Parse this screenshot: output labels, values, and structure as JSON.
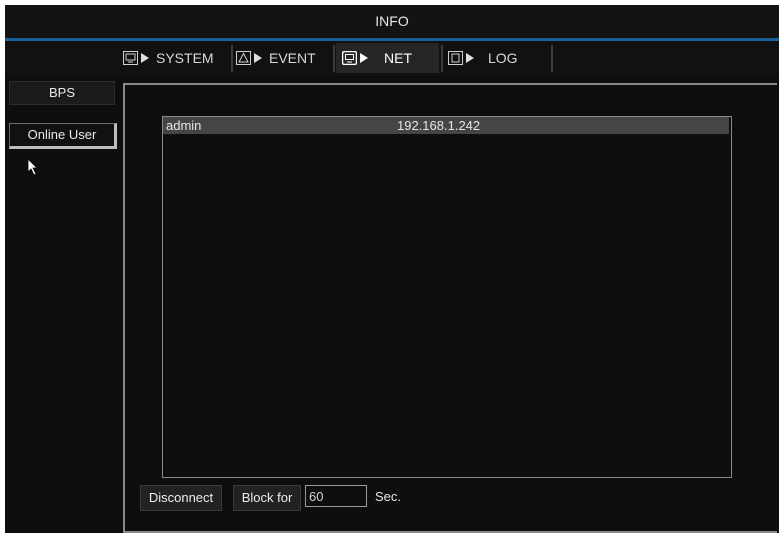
{
  "window": {
    "title": "INFO"
  },
  "tabs": [
    {
      "label": "SYSTEM",
      "icon": "monitor-icon",
      "active": false
    },
    {
      "label": "EVENT",
      "icon": "warning-icon",
      "active": false
    },
    {
      "label": "NET",
      "icon": "network-icon",
      "active": true
    },
    {
      "label": "LOG",
      "icon": "log-icon",
      "active": false
    }
  ],
  "sidebar": {
    "items": [
      {
        "label": "BPS"
      },
      {
        "label": "Online User",
        "selected": true
      }
    ]
  },
  "online_users": [
    {
      "user": "admin",
      "ip": "192.168.1.242"
    }
  ],
  "controls": {
    "disconnect_label": "Disconnect",
    "block_label": "Block for",
    "block_value": "60",
    "sec_label": "Sec."
  },
  "colors": {
    "accent_line": "#1d5f9a",
    "background": "#0e0e0e",
    "row_highlight": "#454545"
  }
}
